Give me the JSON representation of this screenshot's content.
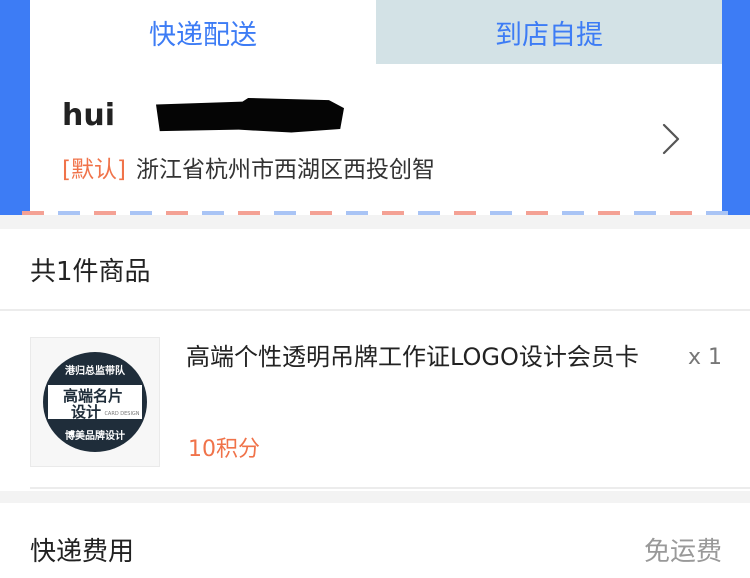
{
  "colors": {
    "accent_blue": "#3d7cf5",
    "orange": "#f0734a",
    "inactive_tab_bg": "#d3e2e6",
    "page_bg": "#f3f3f3"
  },
  "tabs": [
    {
      "label": "快递配送",
      "active": true
    },
    {
      "label": "到店自提",
      "active": false
    }
  ],
  "address": {
    "name": "hui",
    "phone": "",
    "default_tag": "[默认]",
    "full": "浙江省杭州市西湖区西投创智",
    "arrow_icon": "chevron-right-icon"
  },
  "summary": {
    "count_text": "共1件商品"
  },
  "product": {
    "title": "高端个性透明吊牌工作证LOGO设计会员卡",
    "quantity": "x 1",
    "price": "10积分",
    "thumb": {
      "top_text": "港归总监带队",
      "main_line1": "高端名片",
      "main_line2": "设计",
      "side_text": "CARD DESIGN",
      "bottom_text": "博美品牌设计"
    }
  },
  "shipping": {
    "label": "快递费用",
    "value": "免运费"
  }
}
